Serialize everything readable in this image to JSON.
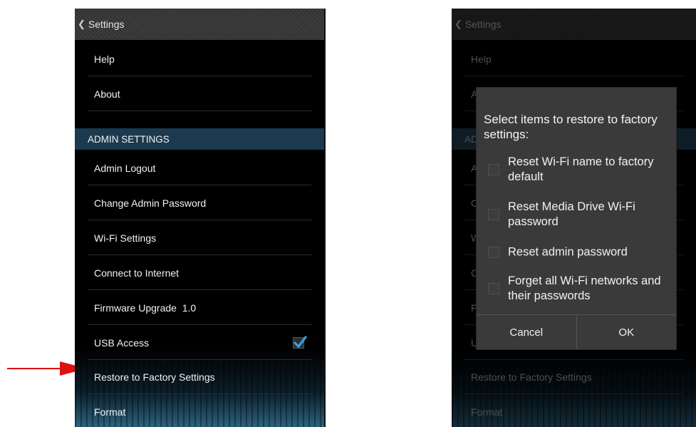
{
  "left_screen": {
    "header": {
      "back_icon": "chevron-left-icon",
      "title": "Settings"
    },
    "items_top": [
      "Help",
      "About"
    ],
    "section_label": "ADMIN SETTINGS",
    "admin_items": [
      "Admin Logout",
      "Change Admin Password",
      "Wi-Fi Settings",
      "Connect to Internet",
      "Firmware Upgrade  1.0",
      "USB Access",
      "Restore to Factory Settings",
      "Format"
    ],
    "usb_access_checked": true,
    "annotation_arrow_color": "#e01010"
  },
  "right_screen": {
    "header": {
      "back_icon": "chevron-left-icon",
      "title": "Settings"
    },
    "background_items": {
      "help": "Help",
      "about_fragment": "A",
      "section_fragment": "AD",
      "admin_logout_fragment": "A",
      "change_pwd_fragment": "C",
      "wifi_fragment": "W",
      "connect_fragment": "C",
      "firmware_fragment": "F",
      "usb_fragment": "U",
      "restore": "Restore to Factory Settings",
      "format": "Format"
    },
    "dialog": {
      "title": "Select items to restore to factory settings:",
      "options": [
        {
          "label": "Reset Wi-Fi name to factory default",
          "checked": false
        },
        {
          "label": "Reset Media Drive Wi-Fi password",
          "checked": false
        },
        {
          "label": "Reset admin password",
          "checked": false
        },
        {
          "label": "Forget all Wi-Fi networks and their passwords",
          "checked": false
        }
      ],
      "cancel_label": "Cancel",
      "ok_label": "OK"
    }
  },
  "colors": {
    "section_bg": "#1c3a4f",
    "checkbox_accent": "#2fa3e6",
    "dialog_bg": "#3a3a3a"
  }
}
